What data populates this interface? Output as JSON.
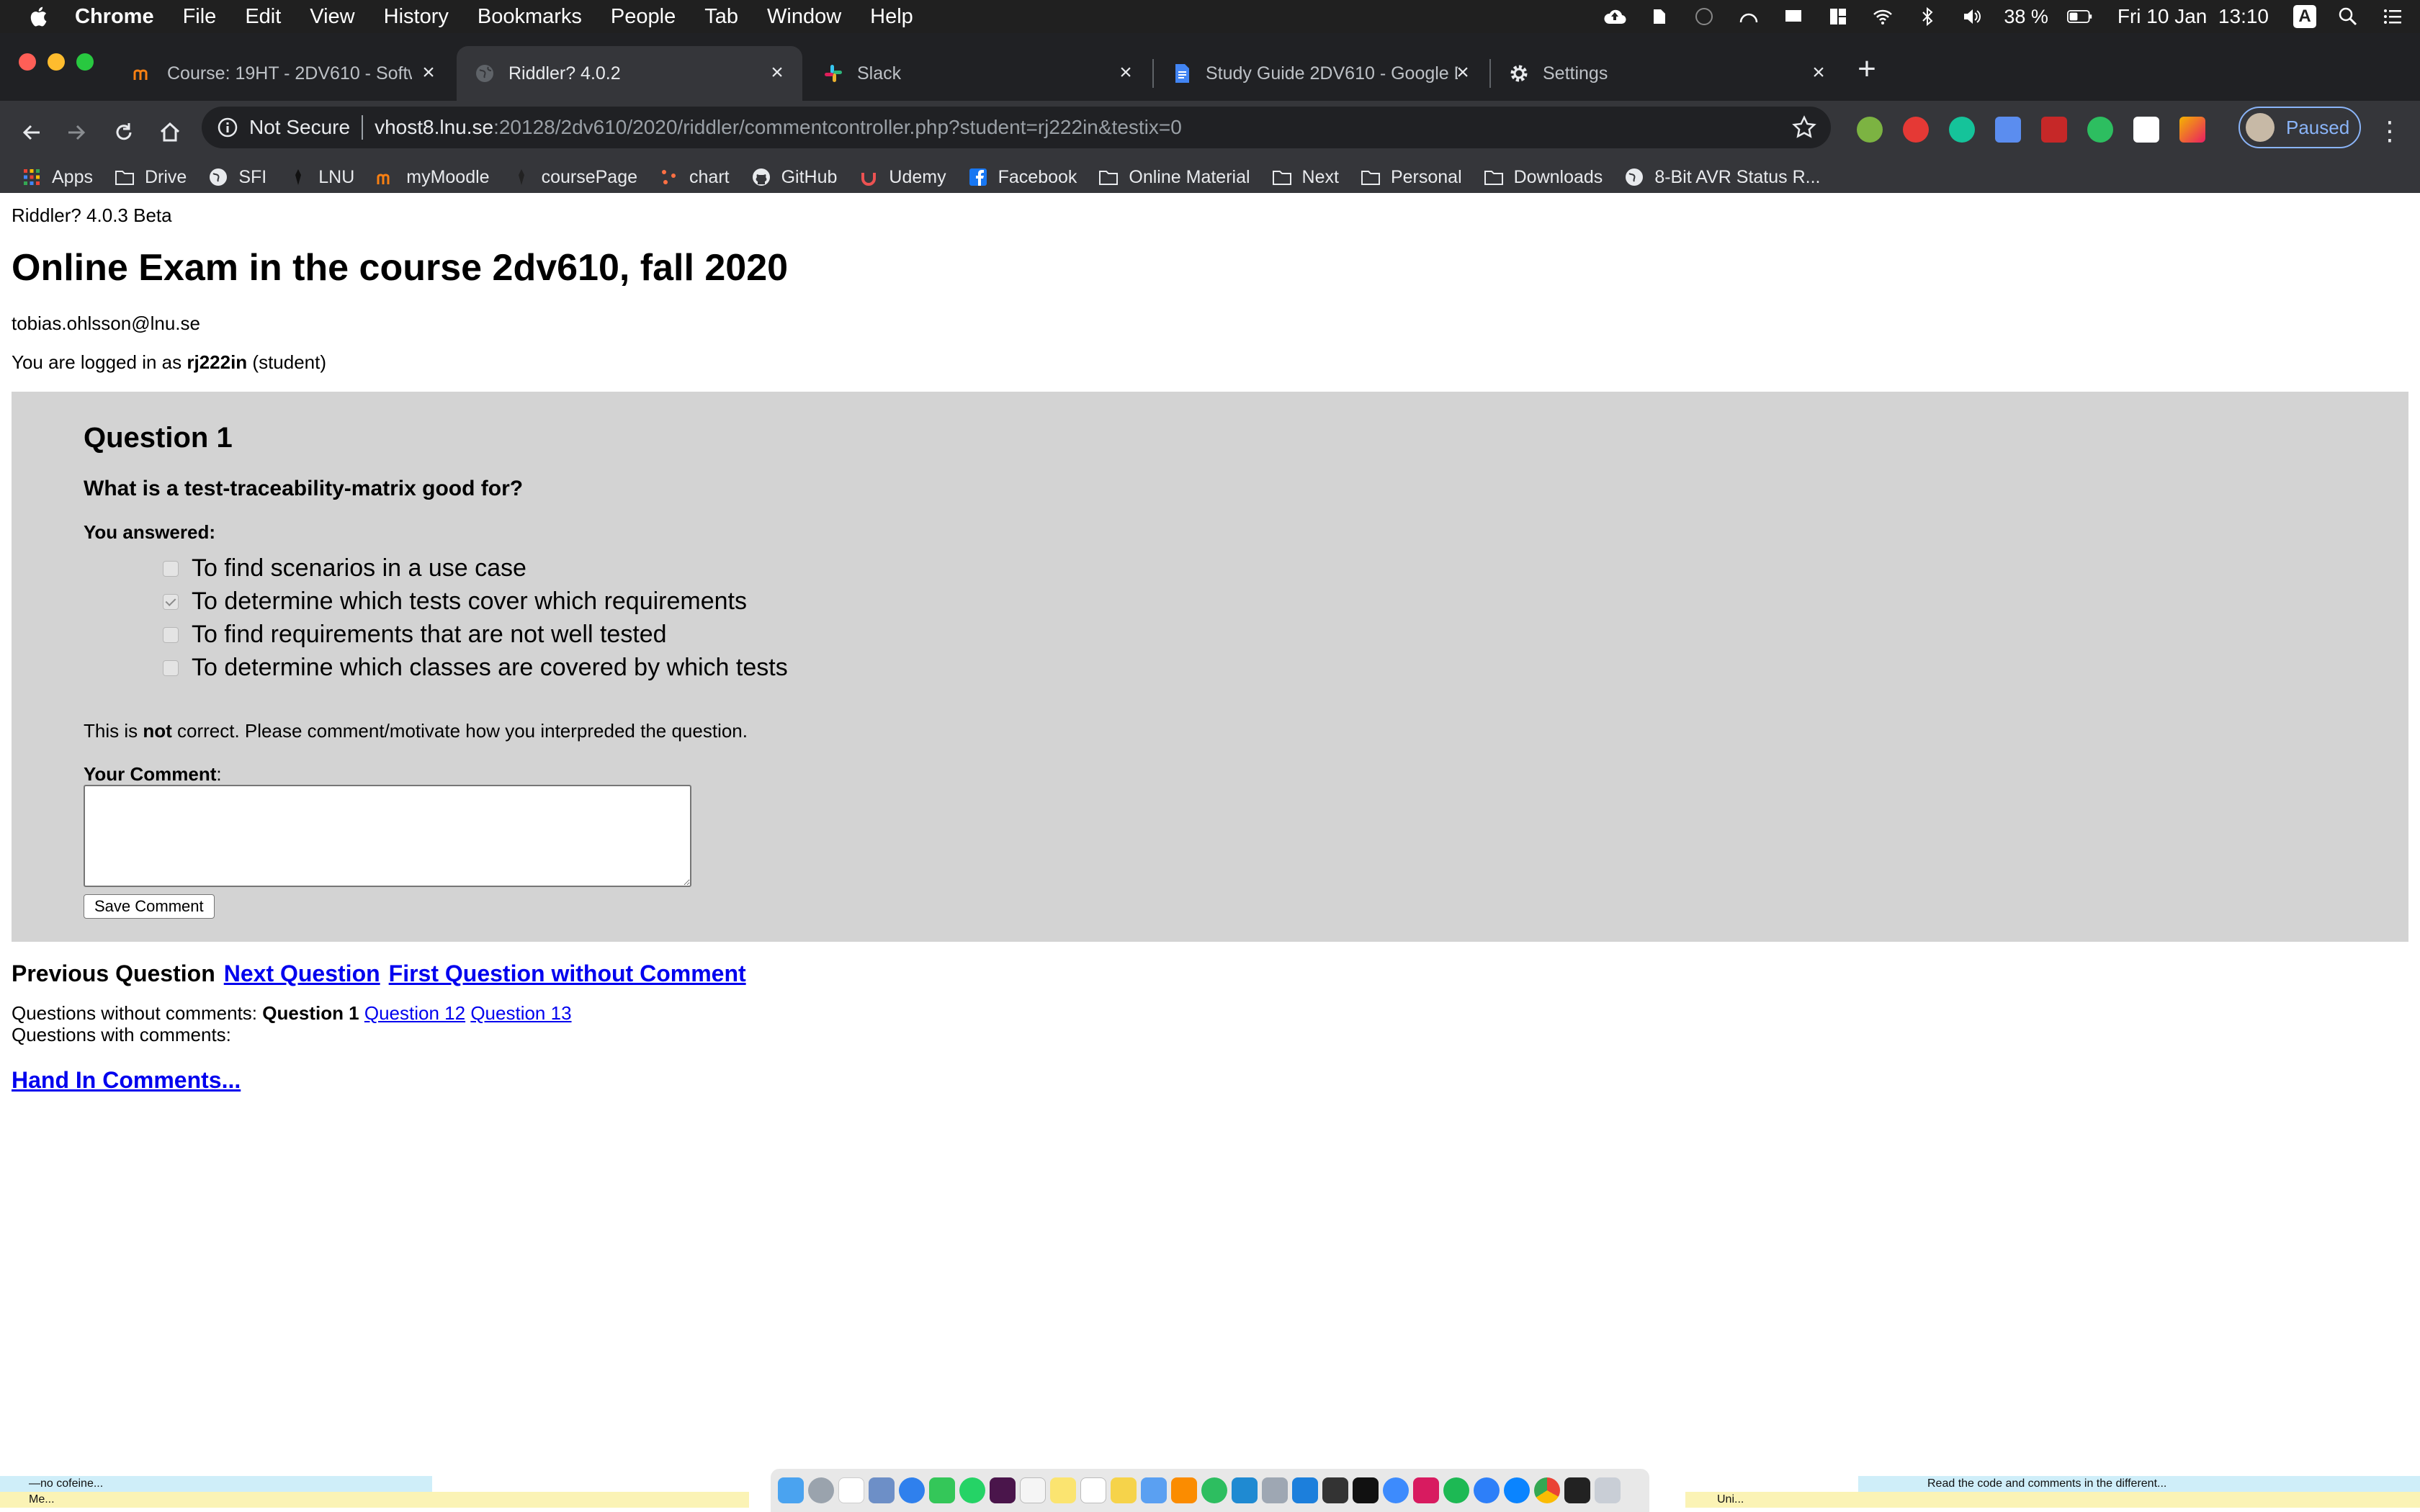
{
  "menubar": {
    "app": "Chrome",
    "items": [
      "File",
      "Edit",
      "View",
      "History",
      "Bookmarks",
      "People",
      "Tab",
      "Window",
      "Help"
    ],
    "battery": "38 %",
    "datetime": "Fri 10 Jan  13:10",
    "input_source": "A"
  },
  "tabs": [
    {
      "title": "Course: 19HT - 2DV610 - Softwa",
      "favicon": "moodle-icon",
      "active": false
    },
    {
      "title": "Riddler? 4.0.2",
      "favicon": "globe-icon",
      "active": true
    },
    {
      "title": "Slack",
      "favicon": "slack-icon",
      "active": false
    },
    {
      "title": "Study Guide 2DV610 - Google D",
      "favicon": "google-docs-icon",
      "active": false
    },
    {
      "title": "Settings",
      "favicon": "gear-icon",
      "active": false
    }
  ],
  "toolbar": {
    "not_secure": "Not Secure",
    "url_host": "vhost8.lnu.se",
    "url_rest": ":20128/2dv610/2020/riddler/commentcontroller.php?student=rj222in&testix=0",
    "profile_label": "Paused"
  },
  "bookmarks": [
    {
      "label": "Apps",
      "icon": "apps-grid-icon"
    },
    {
      "label": "Drive",
      "icon": "folder-icon"
    },
    {
      "label": "SFI",
      "icon": "globe-icon"
    },
    {
      "label": "LNU",
      "icon": "lnu-icon"
    },
    {
      "label": "myMoodle",
      "icon": "moodle-icon"
    },
    {
      "label": "coursePage",
      "icon": "lnu-icon"
    },
    {
      "label": "chart",
      "icon": "chart-icon"
    },
    {
      "label": "GitHub",
      "icon": "github-icon"
    },
    {
      "label": "Udemy",
      "icon": "udemy-icon"
    },
    {
      "label": "Facebook",
      "icon": "facebook-icon"
    },
    {
      "label": "Online Material",
      "icon": "folder-icon"
    },
    {
      "label": "Next",
      "icon": "folder-icon"
    },
    {
      "label": "Personal",
      "icon": "folder-icon"
    },
    {
      "label": "Downloads",
      "icon": "folder-icon"
    },
    {
      "label": "8-Bit AVR Status R...",
      "icon": "globe-icon"
    }
  ],
  "page": {
    "version": "Riddler? 4.0.3 Beta",
    "title": "Online Exam in the course 2dv610, fall 2020",
    "email": "tobias.ohlsson@lnu.se",
    "login_prefix": "You are logged in as",
    "login_user": "rj222in",
    "login_suffix": "(student)"
  },
  "question": {
    "heading": "Question 1",
    "text": "What is a test-traceability-matrix good for?",
    "answered_label": "You answered:",
    "options": [
      {
        "label": "To find scenarios in a use case",
        "checked": false
      },
      {
        "label": "To determine which tests cover which requirements",
        "checked": true
      },
      {
        "label": "To find requirements that are not well tested",
        "checked": false
      },
      {
        "label": "To determine which classes are covered by which tests",
        "checked": false
      }
    ],
    "verdict_prefix": "This is",
    "verdict_bold": "not",
    "verdict_suffix": "correct. Please comment/motivate how you interpreded the question.",
    "comment_label": "Your Comment",
    "comment_colon": ":",
    "comment_value": "",
    "save_label": "Save Comment"
  },
  "navigation": {
    "previous": "Previous Question",
    "next": "Next Question",
    "first_without": "First Question without Comment"
  },
  "comments_status": {
    "without_label": "Questions without comments:",
    "without_current": "Question 1",
    "without_links": [
      "Question 12",
      "Question 13"
    ],
    "with_label": "Questions with comments:"
  },
  "hand_in": "Hand In Comments...",
  "bottom": {
    "left_top": "—no cofeine...",
    "left_bottom": "Me...",
    "right_top": "Read the code and comments in the different...",
    "right_bottom": "Uni..."
  }
}
